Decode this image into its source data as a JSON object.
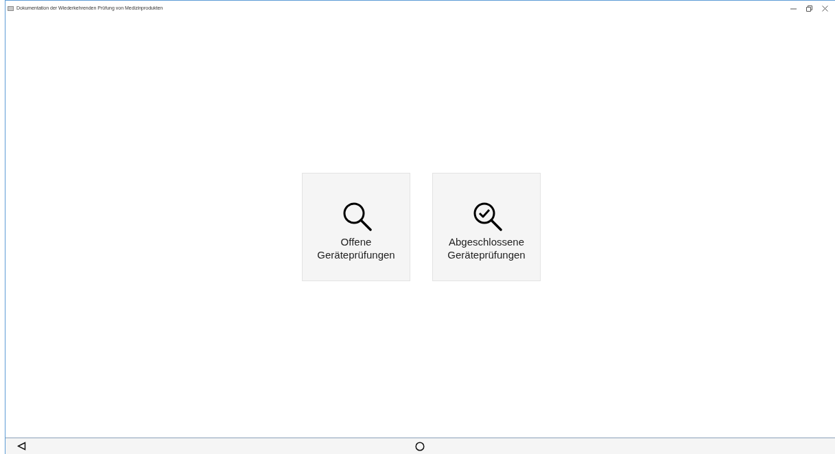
{
  "window": {
    "title": "Dokumentation der Wiederkehrenden Prüfung von Medizinprodukten"
  },
  "tiles": [
    {
      "kind": "search",
      "label": "Offene Geräteprüfungen"
    },
    {
      "kind": "search-check",
      "label": "Abgeschlossene Geräteprüfungen"
    }
  ]
}
